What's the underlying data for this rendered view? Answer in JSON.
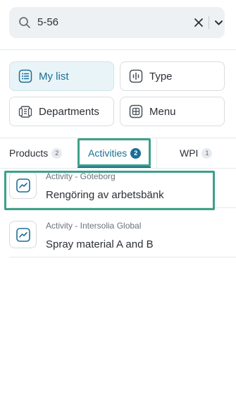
{
  "search": {
    "value": "5-56",
    "icons": {
      "search": "search-icon",
      "clear": "close-icon",
      "dropdown": "chevron-down-icon"
    }
  },
  "filters": [
    {
      "label": "My list",
      "icon": "list-icon",
      "active": true
    },
    {
      "label": "Type",
      "icon": "waveform-icon",
      "active": false
    },
    {
      "label": "Departments",
      "icon": "departments-icon",
      "active": false
    },
    {
      "label": "Menu",
      "icon": "grid-plus-icon",
      "active": false
    }
  ],
  "tabs": [
    {
      "label": "Products",
      "count": "2",
      "active": false
    },
    {
      "label": "Activities",
      "count": "2",
      "active": true
    },
    {
      "label": "WPI",
      "count": "1",
      "active": false
    }
  ],
  "results": [
    {
      "meta": "Activity - Göteborg",
      "title": "Rengöring av arbetsbänk",
      "icon": "trend-line-icon",
      "highlighted": true
    },
    {
      "meta": "Activity - Intersolia Global",
      "title": "Spray material A and B",
      "icon": "trend-line-icon",
      "highlighted": false
    }
  ],
  "colors": {
    "accent": "#1a6f96",
    "highlight": "#3ea08a",
    "active_bg": "#e9f4f8",
    "search_bg": "#eef1f4"
  }
}
